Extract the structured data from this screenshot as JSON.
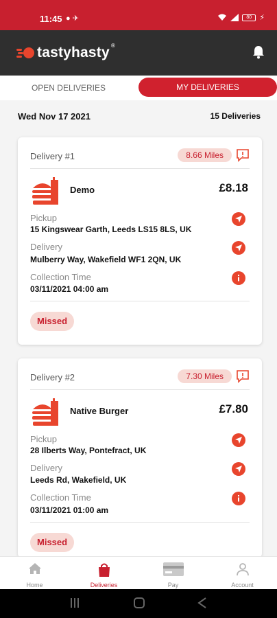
{
  "status": {
    "time": "11:45",
    "battery": "80"
  },
  "app": {
    "name": "tastyhasty",
    "reg": "®"
  },
  "tabs": {
    "open": "OPEN DELIVERIES",
    "mine": "MY DELIVERIES"
  },
  "datebar": {
    "date": "Wed Nov 17 2021",
    "count": "15 Deliveries"
  },
  "cards": [
    {
      "title": "Delivery #1",
      "miles": "8.66 Miles",
      "shop": "Demo",
      "price": "£8.18",
      "pickup_label": "Pickup",
      "pickup": "15 Kingswear Garth, Leeds LS15 8LS, UK",
      "delivery_label": "Delivery",
      "delivery": "Mulberry Way, Wakefield WF1 2QN, UK",
      "time_label": "Collection Time",
      "time": "03/11/2021 04:00 am",
      "status": "Missed"
    },
    {
      "title": "Delivery #2",
      "miles": "7.30 Miles",
      "shop": "Native Burger",
      "price": "£7.80",
      "pickup_label": "Pickup",
      "pickup": "28 Ilberts Way, Pontefract, UK",
      "delivery_label": "Delivery",
      "delivery": "Leeds Rd, Wakefield, UK",
      "time_label": "Collection Time",
      "time": "03/11/2021 01:00 am",
      "status": "Missed"
    }
  ],
  "nav": {
    "home": "Home",
    "deliveries": "Deliveries",
    "pay": "Pay",
    "account": "Account"
  },
  "colors": {
    "brand": "#c8202f",
    "accent": "#e8452d",
    "badge_bg": "#f7d9d4",
    "appbar": "#2f2f2f"
  },
  "icons": [
    "bell-icon",
    "message-alert-icon",
    "burger-bag-icon",
    "navigate-icon",
    "info-icon",
    "home-icon",
    "bag-icon",
    "card-icon",
    "person-icon"
  ]
}
